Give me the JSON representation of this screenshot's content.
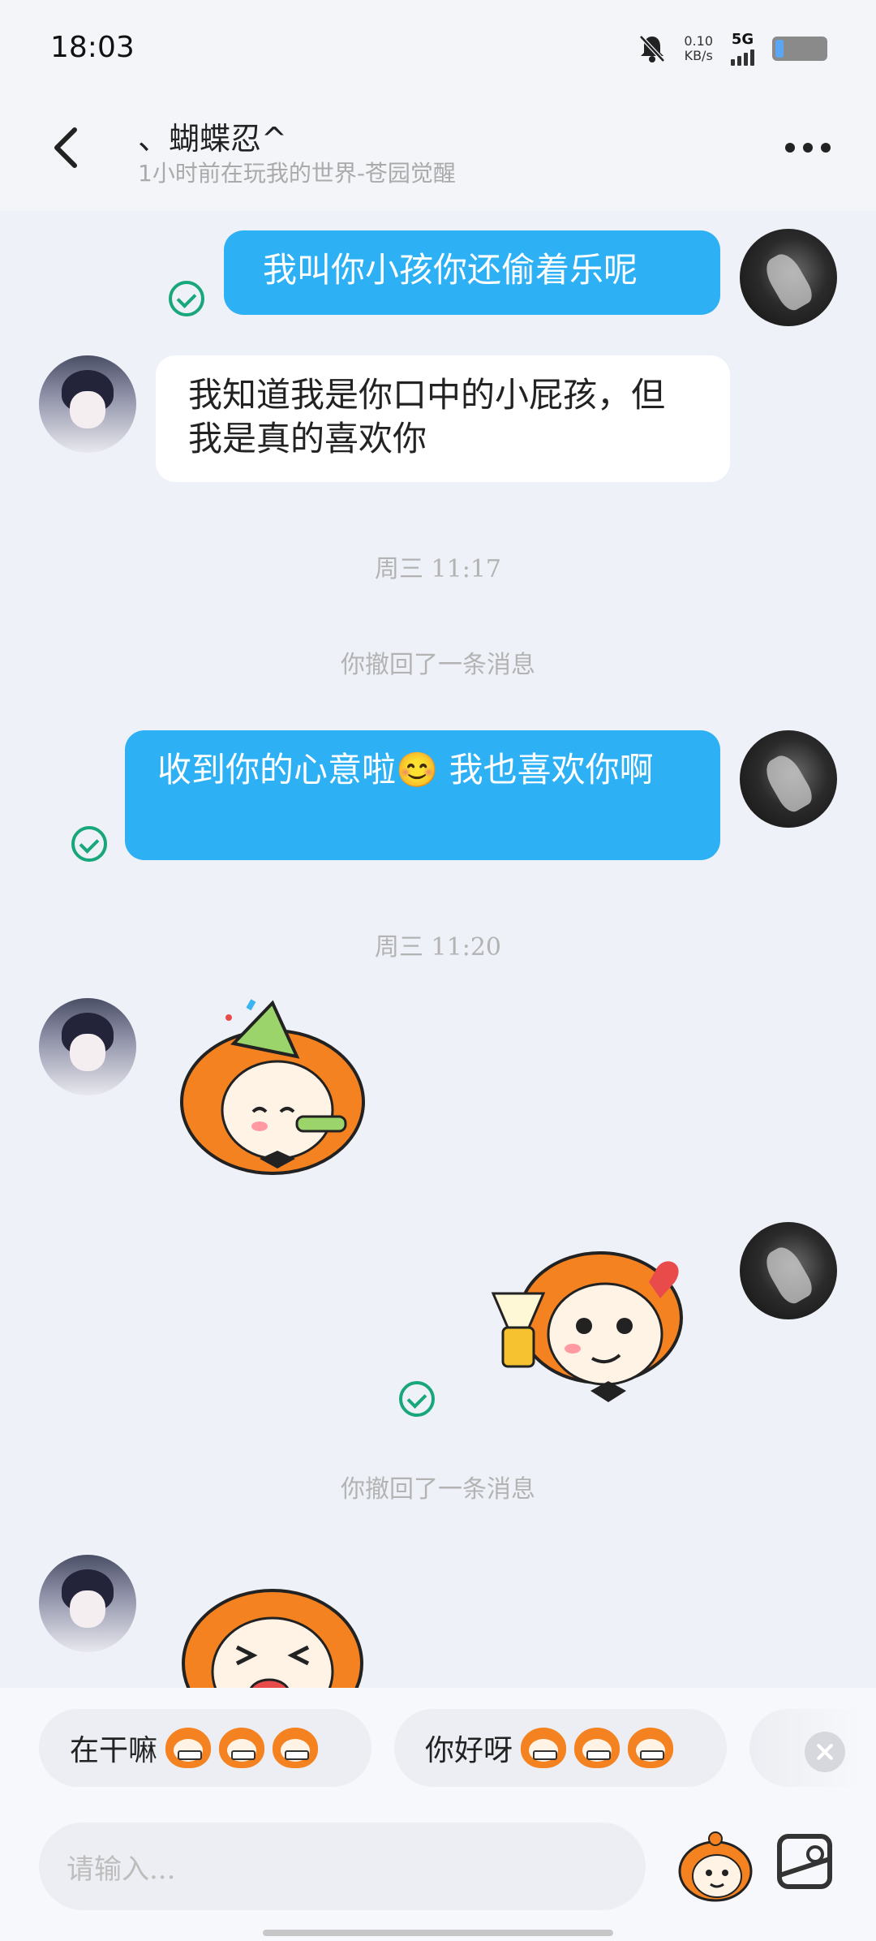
{
  "status_bar": {
    "time": "18:03",
    "net_speed_value": "0.10",
    "net_speed_unit": "KB/s",
    "network": "5G",
    "icons": [
      "bell-muted-icon",
      "signal-icon",
      "battery-icon"
    ]
  },
  "header": {
    "contact_name": "、蝴蝶忍^",
    "contact_status": "1小时前在玩我的世界-苍园觉醒",
    "icons": [
      "back-arrow-icon",
      "more-icon"
    ]
  },
  "messages": [
    {
      "type": "text",
      "from": "me",
      "text": "我叫你小孩你还偷着乐呢",
      "status": "sent"
    },
    {
      "type": "text",
      "from": "other",
      "text": "我知道我是你口中的小屁孩，但我是真的喜欢你"
    },
    {
      "type": "time",
      "text": "周三 11:17"
    },
    {
      "type": "system",
      "text": "你撤回了一条消息"
    },
    {
      "type": "text",
      "from": "me",
      "text": "收到你的心意啦😊 我也喜欢你啊",
      "status": "sent"
    },
    {
      "type": "time",
      "text": "周三 11:20"
    },
    {
      "type": "sticker",
      "from": "other",
      "sticker": "party-horn-sticker"
    },
    {
      "type": "sticker",
      "from": "me",
      "sticker": "cheers-sticker",
      "status": "sent"
    },
    {
      "type": "system",
      "text": "你撤回了一条消息"
    },
    {
      "type": "sticker",
      "from": "other",
      "sticker": "laughing-sticker"
    }
  ],
  "quick_replies": [
    {
      "text": "在干嘛",
      "emoji": [
        "grin-sticker-icon",
        "grin-sticker-icon",
        "grin-sticker-icon"
      ]
    },
    {
      "text": "你好呀",
      "emoji": [
        "wink-sticker-icon",
        "wink-sticker-icon",
        "wink-sticker-icon"
      ]
    }
  ],
  "input": {
    "placeholder": "请输入..."
  },
  "colors": {
    "bubble_me": "#2eb0f5",
    "bubble_other": "#ffffff",
    "sent_check": "#17a77a",
    "chat_bg": "#eef1f7",
    "sticker_orange": "#f58220"
  }
}
